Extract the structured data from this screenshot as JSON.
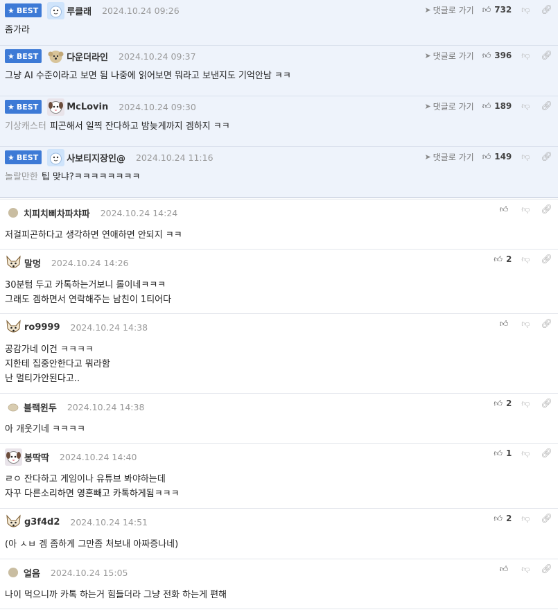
{
  "labels": {
    "best": "BEST",
    "goto": "댓글로 가기"
  },
  "best_comments": [
    {
      "nickname": "루클래",
      "date": "2024.10.24 09:26",
      "likes": "732",
      "tag": "",
      "lines": [
        "좀가라"
      ],
      "avatar": "snowman-avatar"
    },
    {
      "nickname": "다운더라인",
      "date": "2024.10.24 09:37",
      "likes": "396",
      "tag": "",
      "lines": [
        "그냥 AI 수준이라고 보면 됨 나중에 읽어보면 뭐라고 보낸지도 기억안남 ㅋㅋ"
      ],
      "avatar": "puppy-avatar"
    },
    {
      "nickname": "McLovin",
      "date": "2024.10.24 09:30",
      "likes": "189",
      "tag": "기상캐스터",
      "lines": [
        "피곤해서 일찍 잔다하고 밤늦게까지 겜하지 ㅋㅋ"
      ],
      "avatar": "dog-avatar"
    },
    {
      "nickname": "사보티지장인@",
      "date": "2024.10.24 11:16",
      "likes": "149",
      "tag": "놀랄만한",
      "lines": [
        "팁 맞냐?ㅋㅋㅋㅋㅋㅋㅋㅋ"
      ],
      "avatar": "snowman-avatar"
    }
  ],
  "comments": [
    {
      "nickname": "치피치삐차파챠파",
      "date": "2024.10.24 14:24",
      "likes": "",
      "lines": [
        "저걸피곤하다고 생각하면 연애하면 안되지 ㅋㅋ"
      ],
      "avatar": "circle-avatar"
    },
    {
      "nickname": "말멍",
      "date": "2024.10.24 14:26",
      "likes": "2",
      "lines": [
        "30분텀 두고 카톡하는거보니 롤이네ㅋㅋㅋ",
        "그래도 겜하면서 연락해주는 남친이 1티어다"
      ],
      "avatar": "fox-avatar"
    },
    {
      "nickname": "ro9999",
      "date": "2024.10.24 14:38",
      "likes": "",
      "lines": [
        "공감가네 이건 ㅋㅋㅋㅋ",
        "지한테 집중안한다고 뭐라함",
        "난 멀티가안된다고.."
      ],
      "avatar": "fox-avatar"
    },
    {
      "nickname": "블랙윈두",
      "date": "2024.10.24 14:38",
      "likes": "2",
      "lines": [
        "아 개웃기네 ㅋㅋㅋㅋ"
      ],
      "avatar": "blob-avatar"
    },
    {
      "nickname": "봉딱딱",
      "date": "2024.10.24 14:40",
      "likes": "1",
      "lines": [
        "ㄹㅇ 잔다하고 게임이나 유튜브 봐야하는데",
        "자꾸 다른소리하면 영혼빼고 카톡하게됨ㅋㅋㅋ"
      ],
      "avatar": "dog-avatar"
    },
    {
      "nickname": "g3f4d2",
      "date": "2024.10.24 14:51",
      "likes": "2",
      "lines": [
        "(아 ㅅㅂ 겜 좀하게 그만좀 처보내 아짜증나네)"
      ],
      "avatar": "fox-avatar"
    },
    {
      "nickname": "얼음",
      "date": "2024.10.24 15:05",
      "likes": "",
      "lines": [
        "나이 먹으니까 카톡 하는거 힘들더라 그냥 전화 하는게 편해"
      ],
      "avatar": "circle-avatar"
    }
  ]
}
